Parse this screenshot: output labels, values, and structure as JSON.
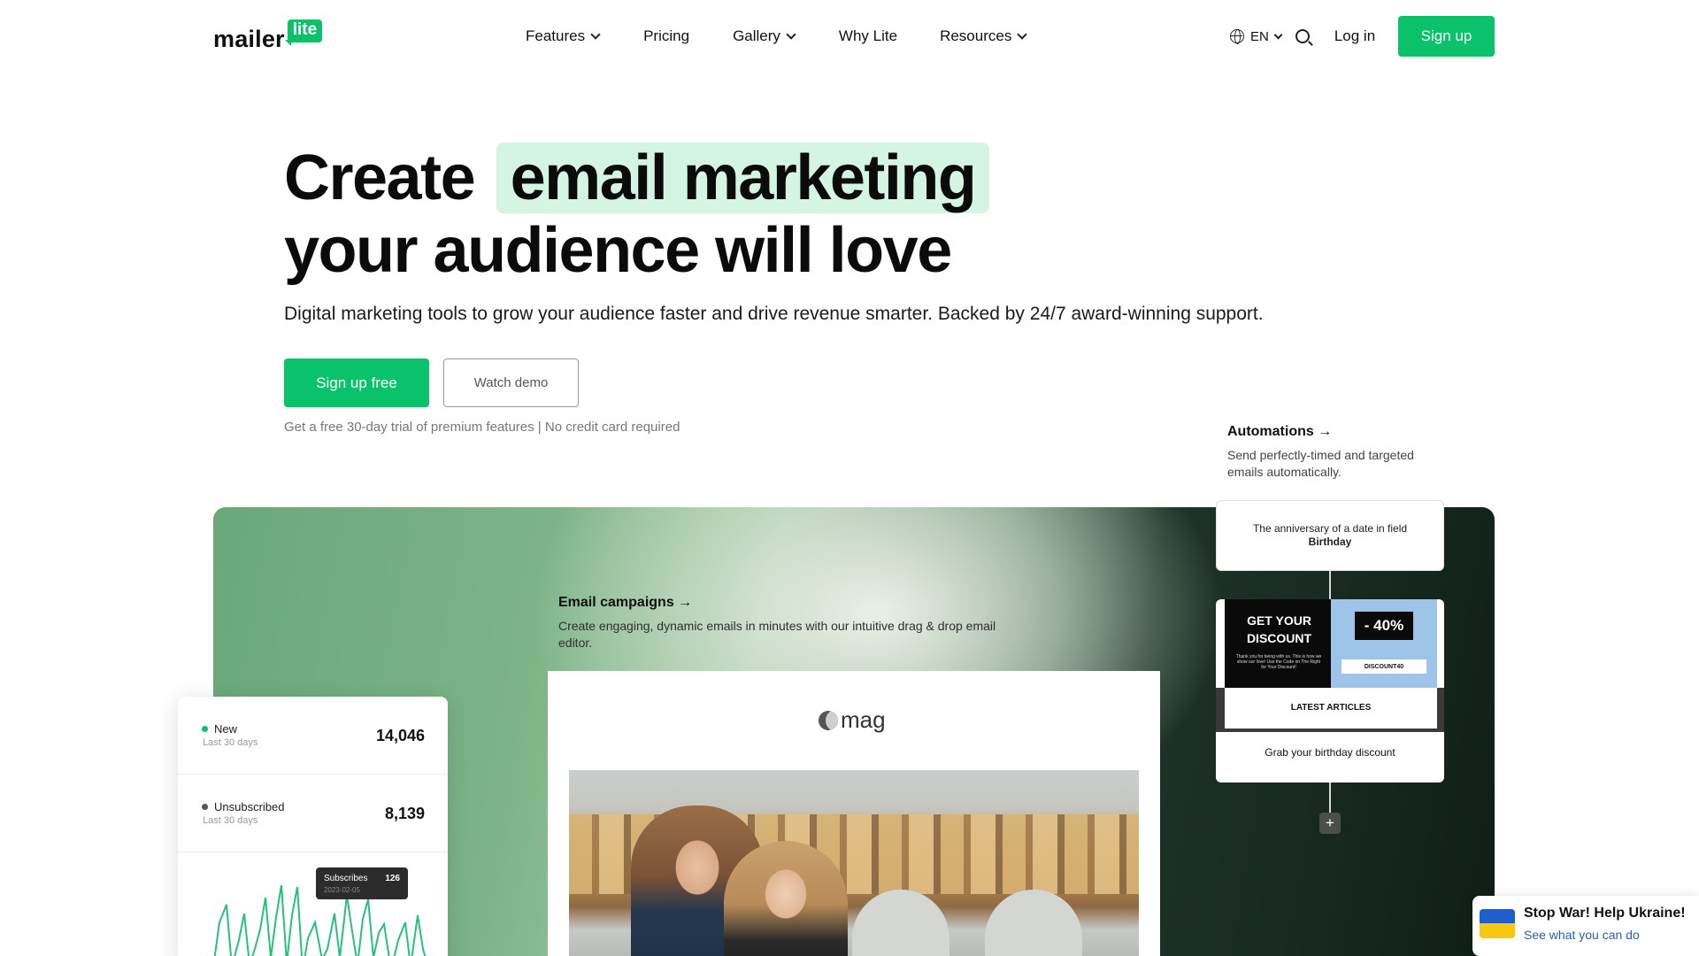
{
  "brand": {
    "logo_word": "mailer",
    "logo_badge": "lite",
    "accent": "#09c269"
  },
  "nav": {
    "items": [
      {
        "label": "Features",
        "dropdown": true
      },
      {
        "label": "Pricing",
        "dropdown": false
      },
      {
        "label": "Gallery",
        "dropdown": true
      },
      {
        "label": "Why Lite",
        "dropdown": false
      },
      {
        "label": "Resources",
        "dropdown": true
      }
    ],
    "language": "EN",
    "login": "Log in",
    "signup": "Sign up"
  },
  "hero": {
    "title_pre": "Create",
    "title_highlight": "email marketing",
    "title_line2": "your audience will love",
    "subtitle": "Digital marketing tools to grow your audience faster and drive revenue smarter. Backed by 24/7 award-winning support.",
    "cta_primary": "Sign up free",
    "cta_secondary": "Watch demo",
    "note": "Get a free 30-day trial of premium features | No credit card required"
  },
  "email_campaigns": {
    "title": "Email campaigns →",
    "description": "Create engaging, dynamic emails in minutes with our intuitive drag & drop email editor.",
    "preview_logo": "mag"
  },
  "stats_card": {
    "rows": [
      {
        "label": "New",
        "sub": "Last 30 days",
        "value": "14,046",
        "dot_color": "#09c269"
      },
      {
        "label": "Unsubscribed",
        "sub": "Last 30 days",
        "value": "8,139",
        "dot_color": "#555555"
      }
    ],
    "tooltip": {
      "label": "Subscribes",
      "date": "2023-02-05",
      "value": "126"
    }
  },
  "automations": {
    "title": "Automations →",
    "description": "Send perfectly-timed and targeted emails automatically.",
    "trigger_text": "The anniversary of a date in field",
    "trigger_field": "Birthday",
    "email_left_title": "GET YOUR DISCOUNT",
    "email_left_small": "Thank you for being with us. This is how we show our love! Use the Code on The Right for Your Discount!",
    "email_badge": "- 40%",
    "email_code": "DISCOUNT40",
    "email_articles": "LATEST ARTICLES",
    "email_caption": "Grab your birthday discount",
    "add_step": "+"
  },
  "ukraine_banner": {
    "title": "Stop War! Help Ukraine!",
    "link": "See what you can do"
  }
}
